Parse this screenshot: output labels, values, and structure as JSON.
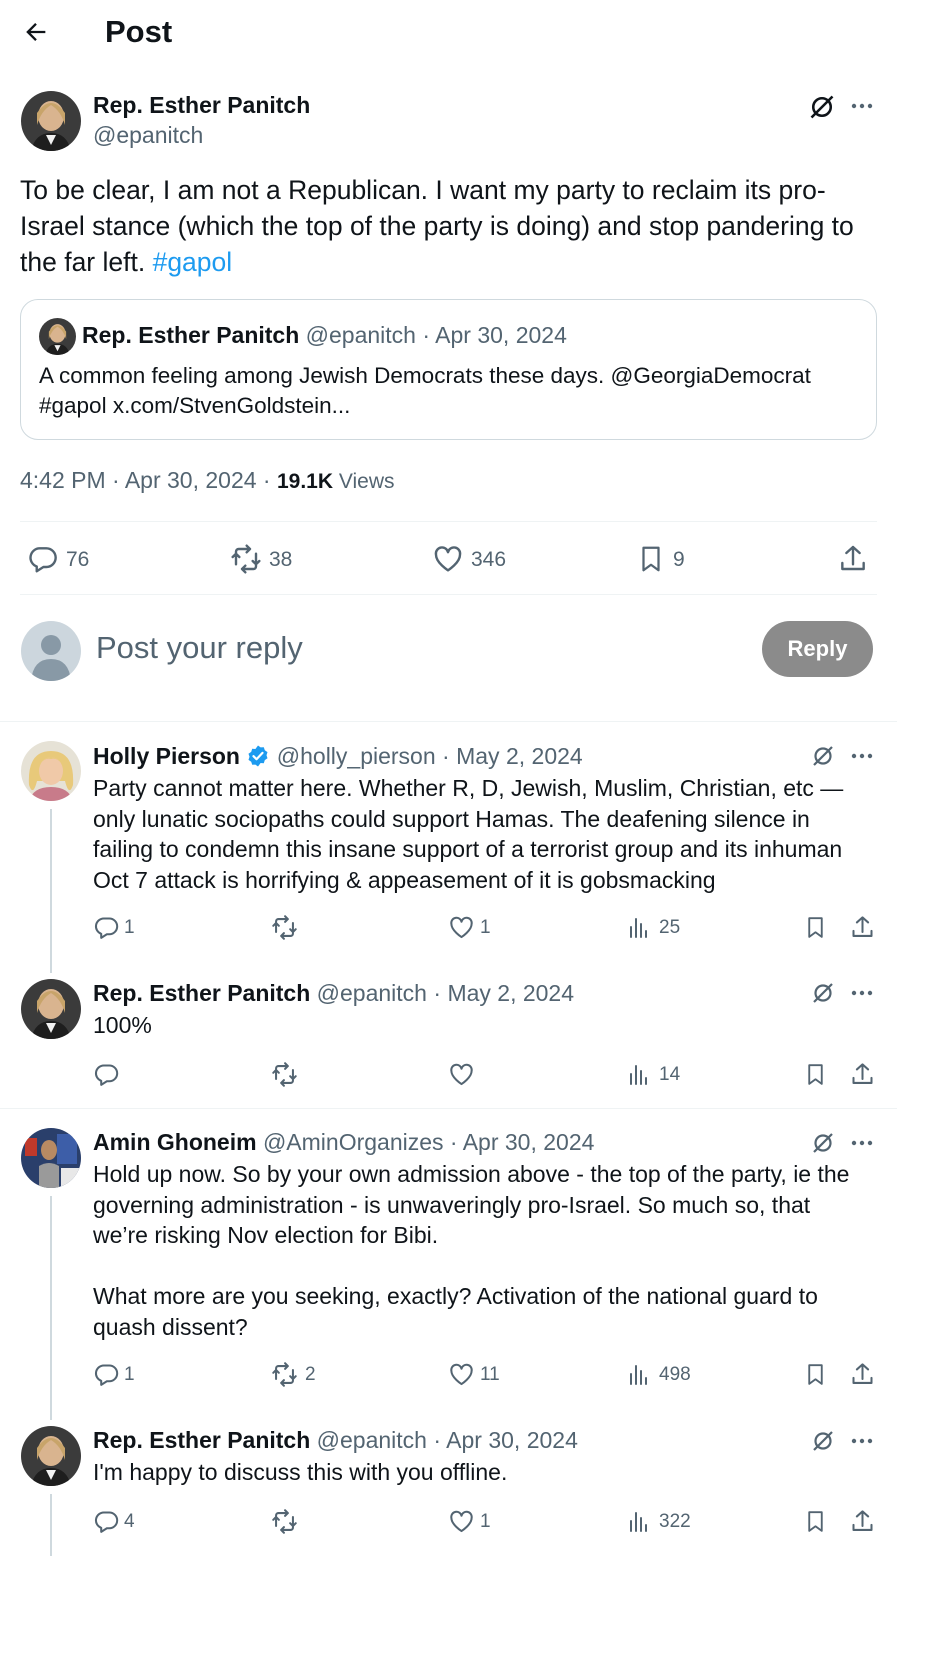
{
  "header": {
    "title": "Post"
  },
  "main_post": {
    "author_name": "Rep. Esther Panitch",
    "author_handle": "@epanitch",
    "text_line1": "To be clear, I am not a Republican. I want my party to reclaim its pro-",
    "text_line2": "Israel stance (which the top of the party is doing) and stop pandering to",
    "text_line3": "the far left. ",
    "hashtag": "#gapol",
    "quote": {
      "author_name": "Rep. Esther Panitch",
      "author_handle": "@epanitch",
      "dot": " · ",
      "date": "Apr 30, 2024",
      "text_line1": "A common feeling among Jewish Democrats these days. @GeorgiaDemocrat",
      "text_line2": "#gapol x.com/StvenGoldstein..."
    },
    "timestamp": "4:42 PM · Apr 30, 2024 · ",
    "views_count": "19.1K",
    "views_label": " Views",
    "stats": {
      "replies": "76",
      "reposts": "38",
      "likes": "346",
      "bookmarks": "9"
    }
  },
  "reply_box": {
    "placeholder": "Post your reply",
    "button": "Reply"
  },
  "replies": [
    {
      "author_name": "Holly Pierson",
      "author_handle": "@holly_pierson",
      "dot": " · ",
      "date": "May 2, 2024",
      "lines": [
        "Party cannot matter here. Whether R, D, Jewish, Muslim, Christian, etc —",
        "only lunatic sociopaths could support Hamas. The deafening silence in",
        "failing to condemn this insane support of a terrorist group and its inhuman",
        "Oct 7 attack is horrifying & appeasement of it is gobsmacking"
      ],
      "stats": {
        "replies": "1",
        "reposts": "",
        "likes": "1",
        "views": "25"
      }
    },
    {
      "author_name": "Rep. Esther Panitch",
      "author_handle": "@epanitch",
      "dot": " · ",
      "date": "May 2, 2024",
      "lines": [
        "100%"
      ],
      "stats": {
        "replies": "",
        "reposts": "",
        "likes": "",
        "views": "14"
      }
    },
    {
      "author_name": "Amin Ghoneim",
      "author_handle": "@AminOrganizes",
      "dot": " · ",
      "date": "Apr 30, 2024",
      "lines": [
        "Hold up now. So by your own admission above - the top of the party, ie the",
        "governing administration - is unwaveringly pro-Israel. So much so, that",
        "we’re risking Nov election for Bibi.",
        "",
        "What more are you seeking, exactly? Activation of the national guard to",
        "quash dissent?"
      ],
      "stats": {
        "replies": "1",
        "reposts": "2",
        "likes": "11",
        "views": "498"
      }
    },
    {
      "author_name": "Rep. Esther Panitch",
      "author_handle": "@epanitch",
      "dot": " · ",
      "date": "Apr 30, 2024",
      "lines": [
        "I'm happy to discuss this with you offline."
      ],
      "stats": {
        "replies": "4",
        "reposts": "",
        "likes": "1",
        "views": "322"
      }
    }
  ],
  "colors": {
    "link": "#1d9bf0",
    "muted": "#536471",
    "reply_button": "#8b8b8b",
    "verified": "#1d9bf0"
  }
}
